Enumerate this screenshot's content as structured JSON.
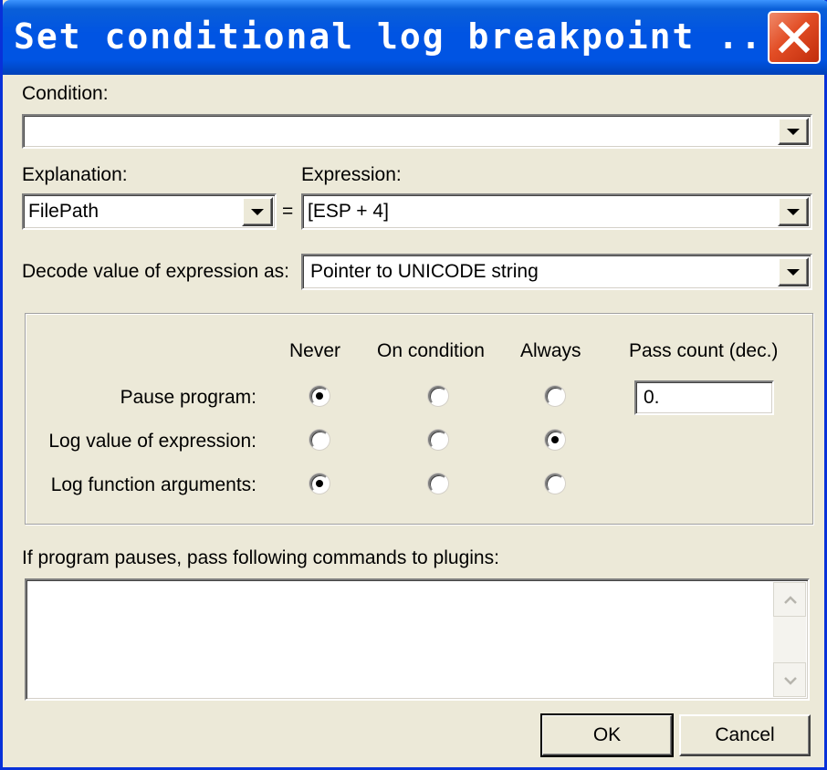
{
  "window": {
    "title": "Set conditional log breakpoint ...",
    "close_icon": "close-x-icon",
    "colors": {
      "titlebar": "#0054e3",
      "close": "#e24d25",
      "face": "#ece9d8"
    }
  },
  "condition": {
    "label": "Condition:",
    "value": ""
  },
  "explanation": {
    "label": "Explanation:",
    "value": "FilePath"
  },
  "equals_sign": "=",
  "expression": {
    "label": "Expression:",
    "value": "[ESP + 4]"
  },
  "decode": {
    "label": "Decode value of expression as:",
    "value": "Pointer to UNICODE string"
  },
  "options": {
    "columns": [
      "Never",
      "On condition",
      "Always"
    ],
    "pass_count_label": "Pass count (dec.)",
    "pass_count_value": "0.",
    "rows": [
      {
        "label": "Pause program:",
        "selected": "Never"
      },
      {
        "label": "Log value of expression:",
        "selected": "Always"
      },
      {
        "label": "Log function arguments:",
        "selected": "Never"
      }
    ]
  },
  "plugins": {
    "label": "If program pauses, pass following commands to plugins:",
    "value": ""
  },
  "buttons": {
    "ok": "OK",
    "cancel": "Cancel"
  }
}
